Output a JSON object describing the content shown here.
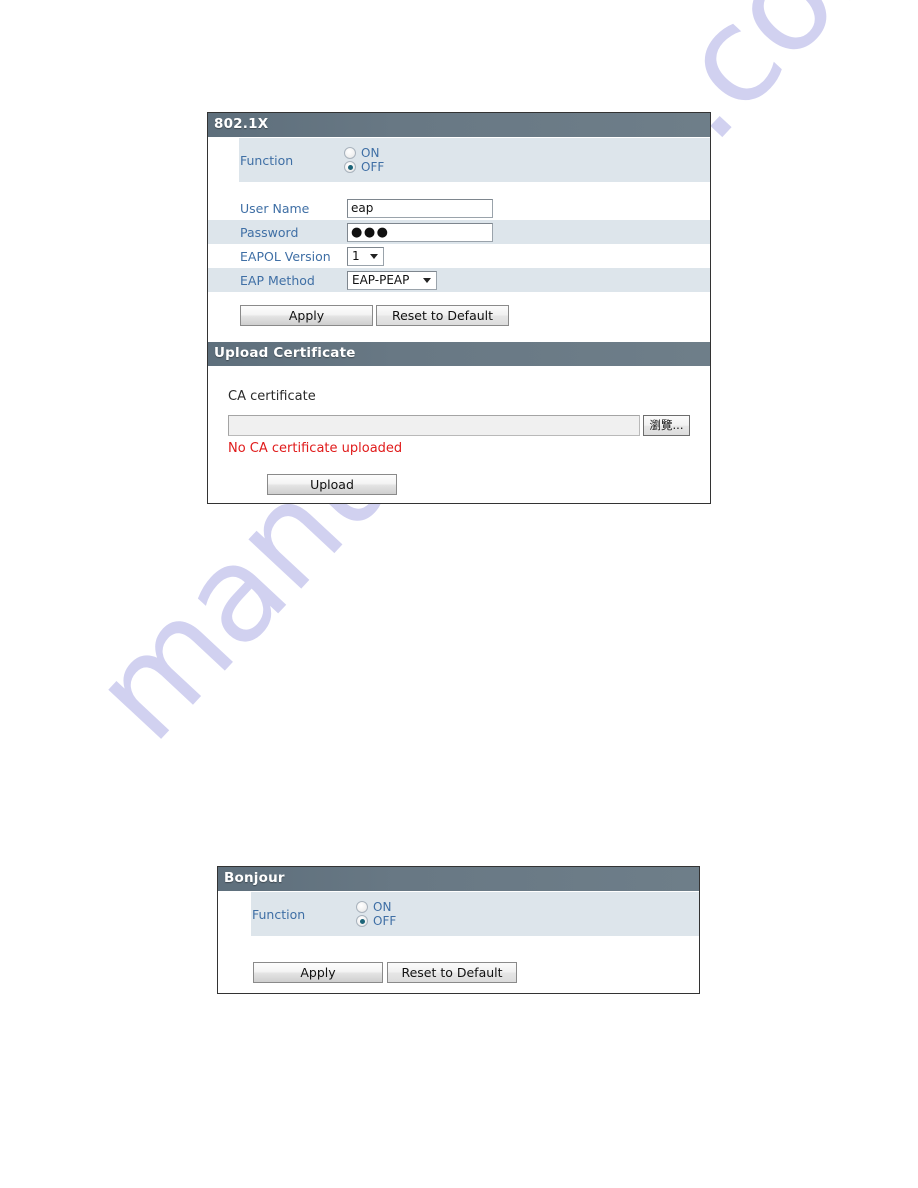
{
  "watermark": {
    "text": "manualshive.com"
  },
  "panels": {
    "dot1x": {
      "title": "802.1X",
      "function": {
        "label": "Function",
        "options": [
          {
            "label": "ON",
            "selected": false
          },
          {
            "label": "OFF",
            "selected": true
          }
        ]
      },
      "fields": [
        {
          "label": "User Name",
          "type": "text",
          "value": "eap"
        },
        {
          "label": "Password",
          "type": "password",
          "value": "●●●"
        },
        {
          "label": "EAPOL Version",
          "type": "select",
          "value": "1"
        },
        {
          "label": "EAP Method",
          "type": "select",
          "value": "EAP-PEAP"
        }
      ],
      "buttons": {
        "apply": "Apply",
        "reset": "Reset to Default"
      }
    },
    "upload_certificate": {
      "title": "Upload Certificate",
      "ca_label": "CA certificate",
      "file_value": "",
      "browse_label": "瀏覽...",
      "status_message": "No CA certificate uploaded",
      "upload_label": "Upload"
    },
    "bonjour": {
      "title": "Bonjour",
      "function": {
        "label": "Function",
        "options": [
          {
            "label": "ON",
            "selected": false
          },
          {
            "label": "OFF",
            "selected": true
          }
        ]
      },
      "buttons": {
        "apply": "Apply",
        "reset": "Reset to Default"
      }
    }
  },
  "colors": {
    "header_bar": "#687884",
    "row_stripe": "#dde5eb",
    "label_blue": "#3f6fa5",
    "error_red": "#e01b1b",
    "radio_dot": "#1c6478",
    "watermark": "#c9c9ee"
  }
}
